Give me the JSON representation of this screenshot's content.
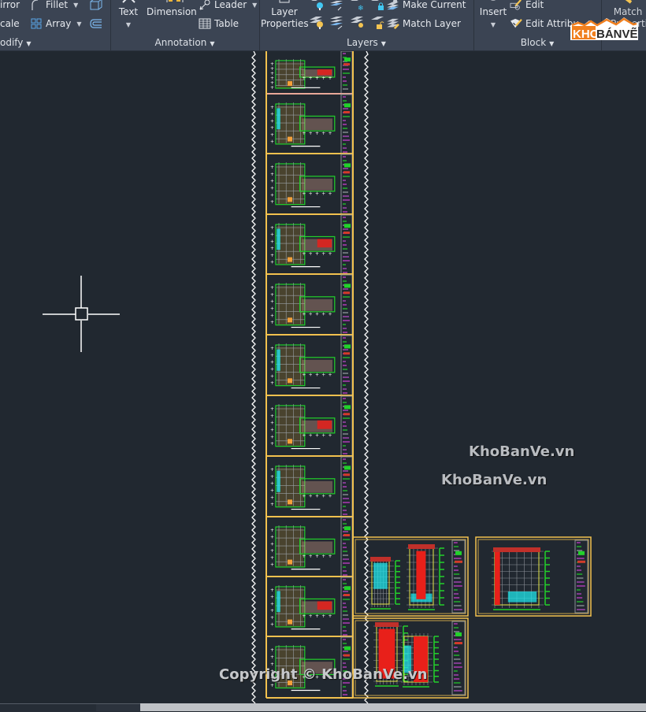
{
  "ribbon": {
    "panels": {
      "modify": {
        "title": "odify",
        "items": {
          "mirror": "irror",
          "scale": "cale",
          "fillet": "Fillet",
          "array": "Array"
        }
      },
      "annotation": {
        "title": "Annotation",
        "items": {
          "text": "Text",
          "dimension": "Dimension",
          "leader": "Leader",
          "table": "Table"
        }
      },
      "layers": {
        "title": "Layers",
        "items": {
          "layer_properties_line1": "Layer",
          "layer_properties_line2": "Properties",
          "make_current": "Make Current",
          "match_layer": "Match Layer"
        }
      },
      "block": {
        "title": "Block",
        "items": {
          "insert": "Insert",
          "edit": "Edit",
          "edit_attributes": "Edit Attribu"
        }
      },
      "properties": {
        "items": {
          "match_line1": "Match",
          "match_line2": "Properties"
        }
      }
    }
  },
  "logo": {
    "part1": "KHO",
    "part2": "BÁNVẼ"
  },
  "canvas": {
    "crosshair_icon": "crosshair-cursor",
    "watermarks": [
      "KhoBanVe.vn",
      "KhoBanVe.vn"
    ],
    "copyright": "Copyright © KhoBanVe.vn",
    "colors": {
      "background": "#212830",
      "frame": "#f2c14e",
      "floorplan_green": "#22d12a",
      "accent_red": "#e8201a",
      "accent_cyan": "#1fe3e8",
      "title_block_magenta": "#d23fd6"
    },
    "sheets": {
      "column_count": 11,
      "elevation_sheets": 3
    }
  }
}
